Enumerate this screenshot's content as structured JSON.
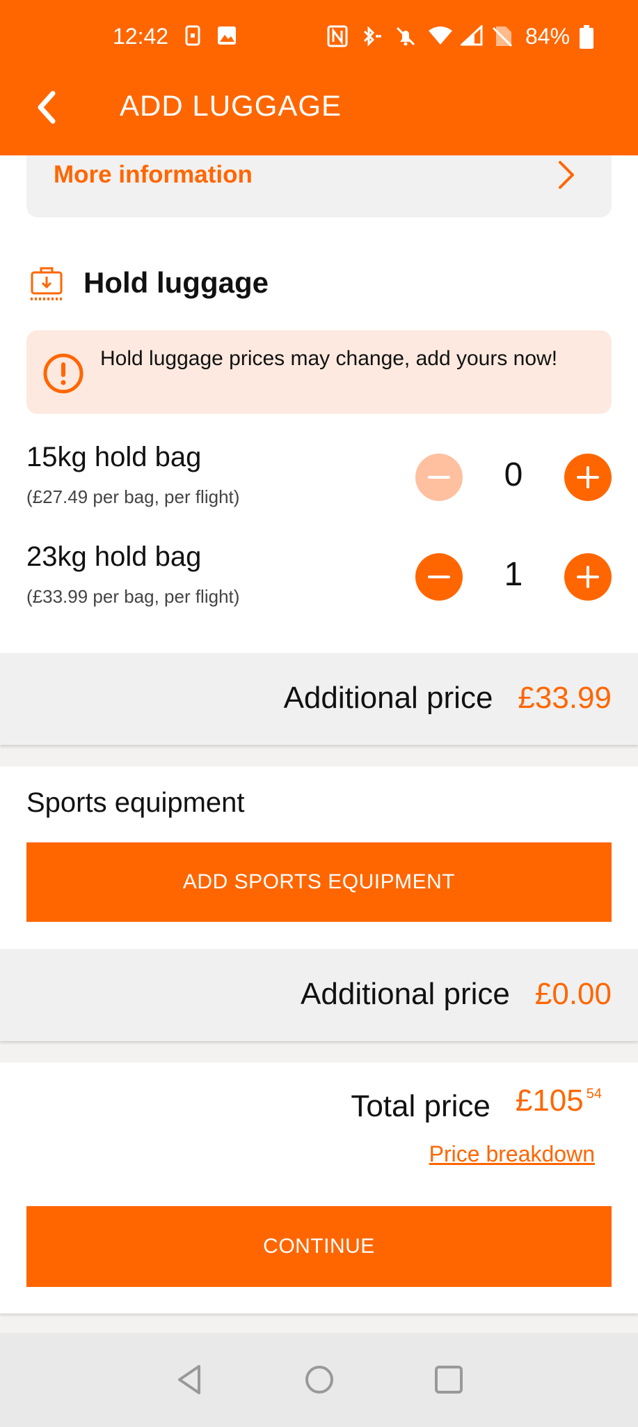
{
  "status_bar": {
    "time": "12:42",
    "battery": "84%",
    "icons": [
      "sim-icon",
      "image-icon",
      "nfc-icon",
      "bluetooth-icon",
      "mute-icon",
      "wifi-icon",
      "signal-icon",
      "no-sim-icon",
      "battery-icon"
    ]
  },
  "header": {
    "title": "ADD LUGGAGE",
    "back_icon": "chevron-left-icon"
  },
  "more_info": {
    "label": "More information"
  },
  "hold_luggage": {
    "title": "Hold luggage",
    "alert": "Hold luggage prices may change, add yours now!",
    "bags": [
      {
        "name": "15kg hold bag",
        "price": "(£27.49 per bag, per flight)",
        "count": "0",
        "minus_disabled": true
      },
      {
        "name": "23kg hold bag",
        "price": "(£33.99 per bag, per flight)",
        "count": "1",
        "minus_disabled": false
      }
    ],
    "additional_label": "Additional price",
    "additional_amount": "£33.99"
  },
  "sports": {
    "title": "Sports equipment",
    "button": "ADD SPORTS EQUIPMENT",
    "additional_label": "Additional price",
    "additional_amount": "£0.00"
  },
  "total": {
    "label": "Total price",
    "amount": "£105",
    "pence": "54",
    "breakdown": "Price breakdown"
  },
  "continue_button": "CONTINUE",
  "colors": {
    "brand": "#ff6600",
    "alert_bg": "#fde9df"
  }
}
